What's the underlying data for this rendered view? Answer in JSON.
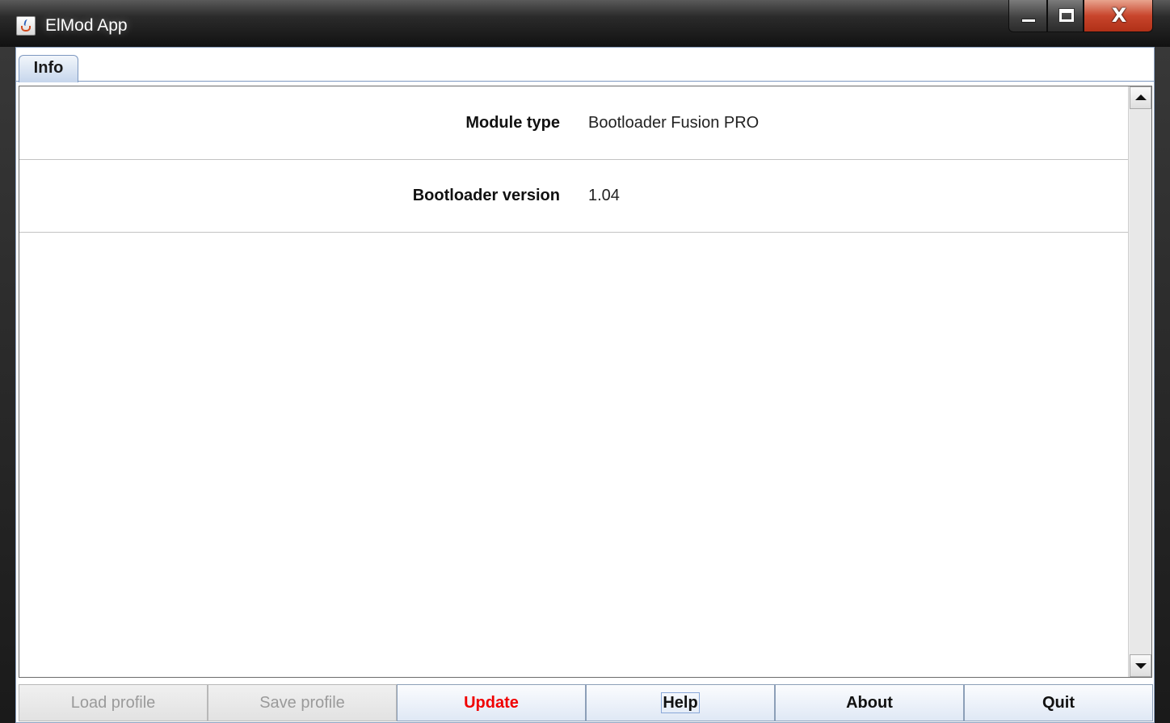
{
  "window": {
    "title": "ElMod App",
    "icon": "java-cup-icon",
    "controls": {
      "minimize": "minimize-icon",
      "maximize": "maximize-icon",
      "close_glyph": "X"
    }
  },
  "tabs": [
    {
      "label": "Info",
      "selected": true
    }
  ],
  "info_rows": [
    {
      "label": "Module type",
      "value": "Bootloader Fusion PRO"
    },
    {
      "label": "Bootloader version",
      "value": "1.04"
    }
  ],
  "buttons": {
    "load_profile": {
      "label": "Load profile",
      "enabled": false
    },
    "save_profile": {
      "label": "Save profile",
      "enabled": false
    },
    "update": {
      "label": "Update",
      "enabled": true,
      "color": "#f00000"
    },
    "help": {
      "label": "Help",
      "enabled": true,
      "focused": true
    },
    "about": {
      "label": "About",
      "enabled": true
    },
    "quit": {
      "label": "Quit",
      "enabled": true
    }
  },
  "colors": {
    "tab_accent": "#c6d6ec",
    "button_border": "#8c9fb8"
  }
}
